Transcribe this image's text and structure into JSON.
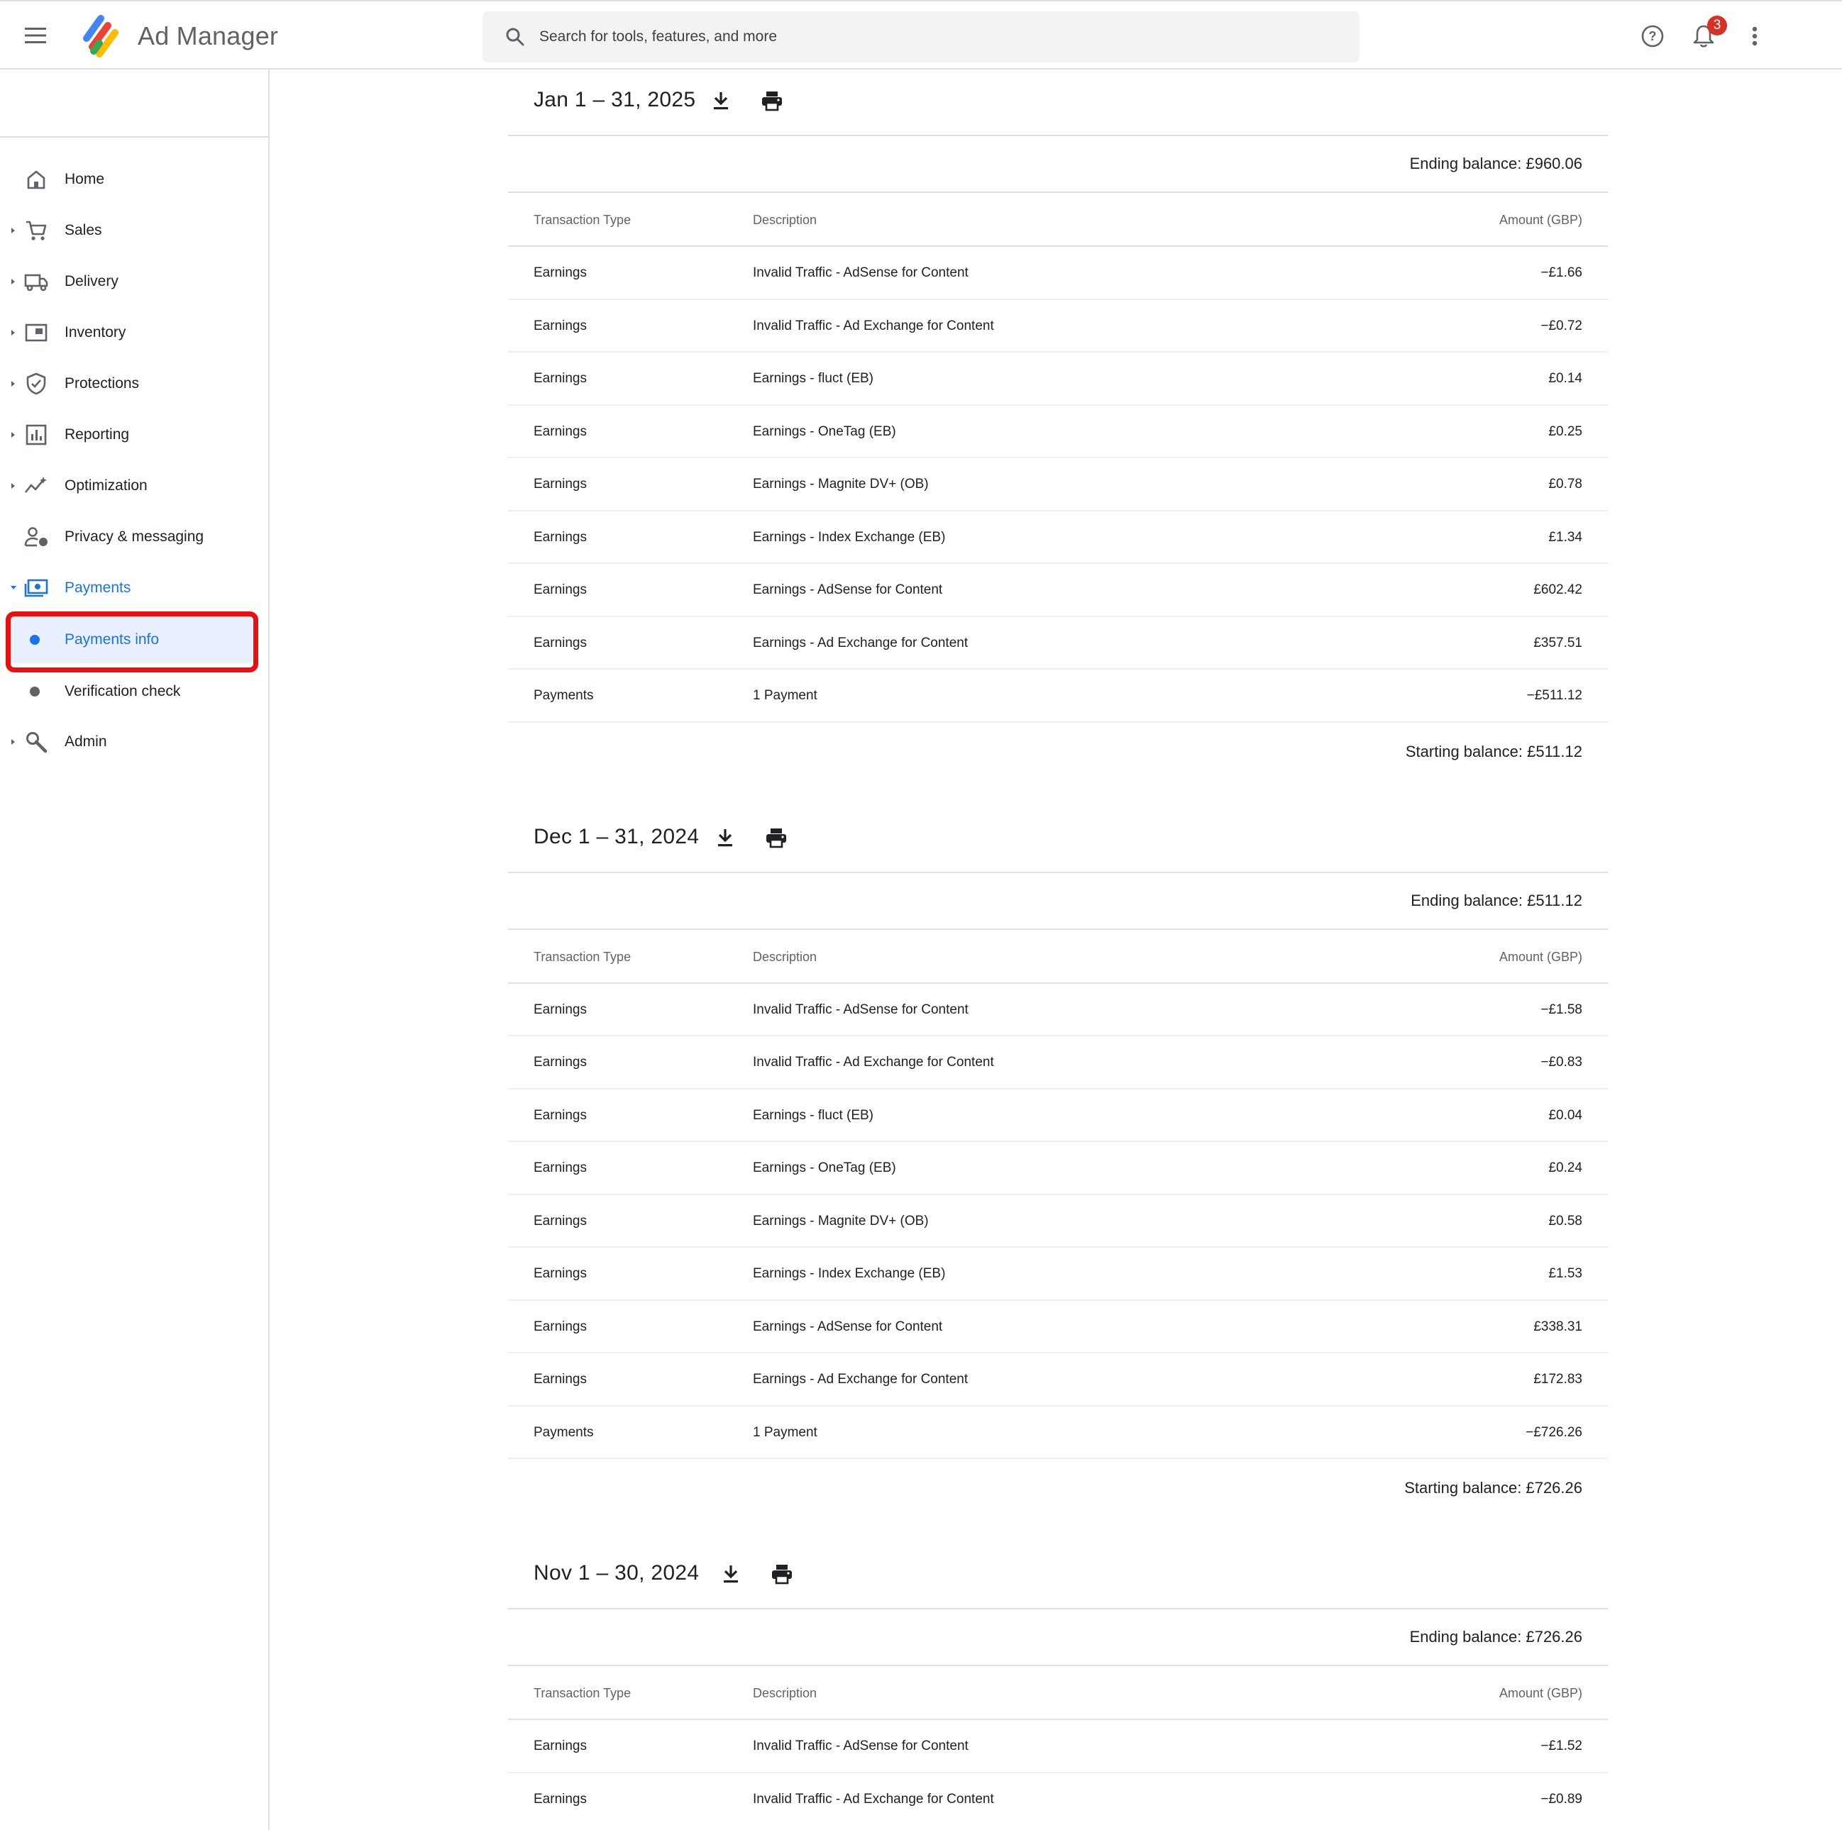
{
  "header": {
    "app_name": "Ad Manager",
    "search_placeholder": "Search for tools, features, and more",
    "notification_count": "3"
  },
  "sidebar": {
    "items": [
      {
        "label": "Home",
        "icon": "home-icon"
      },
      {
        "label": "Sales",
        "icon": "cart-icon"
      },
      {
        "label": "Delivery",
        "icon": "truck-icon"
      },
      {
        "label": "Inventory",
        "icon": "inventory-icon"
      },
      {
        "label": "Protections",
        "icon": "shield-icon"
      },
      {
        "label": "Reporting",
        "icon": "bar-chart-icon"
      },
      {
        "label": "Optimization",
        "icon": "trend-icon"
      },
      {
        "label": "Privacy & messaging",
        "icon": "person-lock-icon"
      },
      {
        "label": "Payments",
        "icon": "payments-icon"
      }
    ],
    "sub_items": [
      {
        "label": "Payments info"
      },
      {
        "label": "Verification check"
      }
    ],
    "admin": {
      "label": "Admin",
      "icon": "wrench-icon"
    }
  },
  "columns": {
    "type": "Transaction Type",
    "description": "Description",
    "amount": "Amount (GBP)"
  },
  "statements": [
    {
      "period": "Jan 1 – 31, 2025",
      "ending_balance": "Ending balance: £960.06",
      "starting_balance": "Starting balance: £511.12",
      "rows": [
        {
          "type": "Earnings",
          "description": "Invalid Traffic - AdSense for Content",
          "amount": "−£1.66"
        },
        {
          "type": "Earnings",
          "description": "Invalid Traffic - Ad Exchange for Content",
          "amount": "−£0.72"
        },
        {
          "type": "Earnings",
          "description": "Earnings - fluct (EB)",
          "amount": "£0.14"
        },
        {
          "type": "Earnings",
          "description": "Earnings - OneTag (EB)",
          "amount": "£0.25"
        },
        {
          "type": "Earnings",
          "description": "Earnings - Magnite DV+ (OB)",
          "amount": "£0.78"
        },
        {
          "type": "Earnings",
          "description": "Earnings - Index Exchange (EB)",
          "amount": "£1.34"
        },
        {
          "type": "Earnings",
          "description": "Earnings - AdSense for Content",
          "amount": "£602.42"
        },
        {
          "type": "Earnings",
          "description": "Earnings - Ad Exchange for Content",
          "amount": "£357.51"
        },
        {
          "type": "Payments",
          "description": "1 Payment",
          "amount": "−£511.12"
        }
      ]
    },
    {
      "period": "Dec 1 – 31, 2024",
      "ending_balance": "Ending balance: £511.12",
      "starting_balance": "Starting balance: £726.26",
      "rows": [
        {
          "type": "Earnings",
          "description": "Invalid Traffic - AdSense for Content",
          "amount": "−£1.58"
        },
        {
          "type": "Earnings",
          "description": "Invalid Traffic - Ad Exchange for Content",
          "amount": "−£0.83"
        },
        {
          "type": "Earnings",
          "description": "Earnings - fluct (EB)",
          "amount": "£0.04"
        },
        {
          "type": "Earnings",
          "description": "Earnings - OneTag (EB)",
          "amount": "£0.24"
        },
        {
          "type": "Earnings",
          "description": "Earnings - Magnite DV+ (OB)",
          "amount": "£0.58"
        },
        {
          "type": "Earnings",
          "description": "Earnings - Index Exchange (EB)",
          "amount": "£1.53"
        },
        {
          "type": "Earnings",
          "description": "Earnings - AdSense for Content",
          "amount": "£338.31"
        },
        {
          "type": "Earnings",
          "description": "Earnings - Ad Exchange for Content",
          "amount": "£172.83"
        },
        {
          "type": "Payments",
          "description": "1 Payment",
          "amount": "−£726.26"
        }
      ]
    },
    {
      "period": "Nov 1 – 30, 2024",
      "ending_balance": "Ending balance: £726.26",
      "starting_balance": "",
      "rows": [
        {
          "type": "Earnings",
          "description": "Invalid Traffic - AdSense for Content",
          "amount": "−£1.52"
        },
        {
          "type": "Earnings",
          "description": "Invalid Traffic - Ad Exchange for Content",
          "amount": "−£0.89"
        }
      ]
    }
  ],
  "colors": {
    "accent": "#1a73e8",
    "highlight": "#e8110f",
    "badge": "#d93025"
  }
}
